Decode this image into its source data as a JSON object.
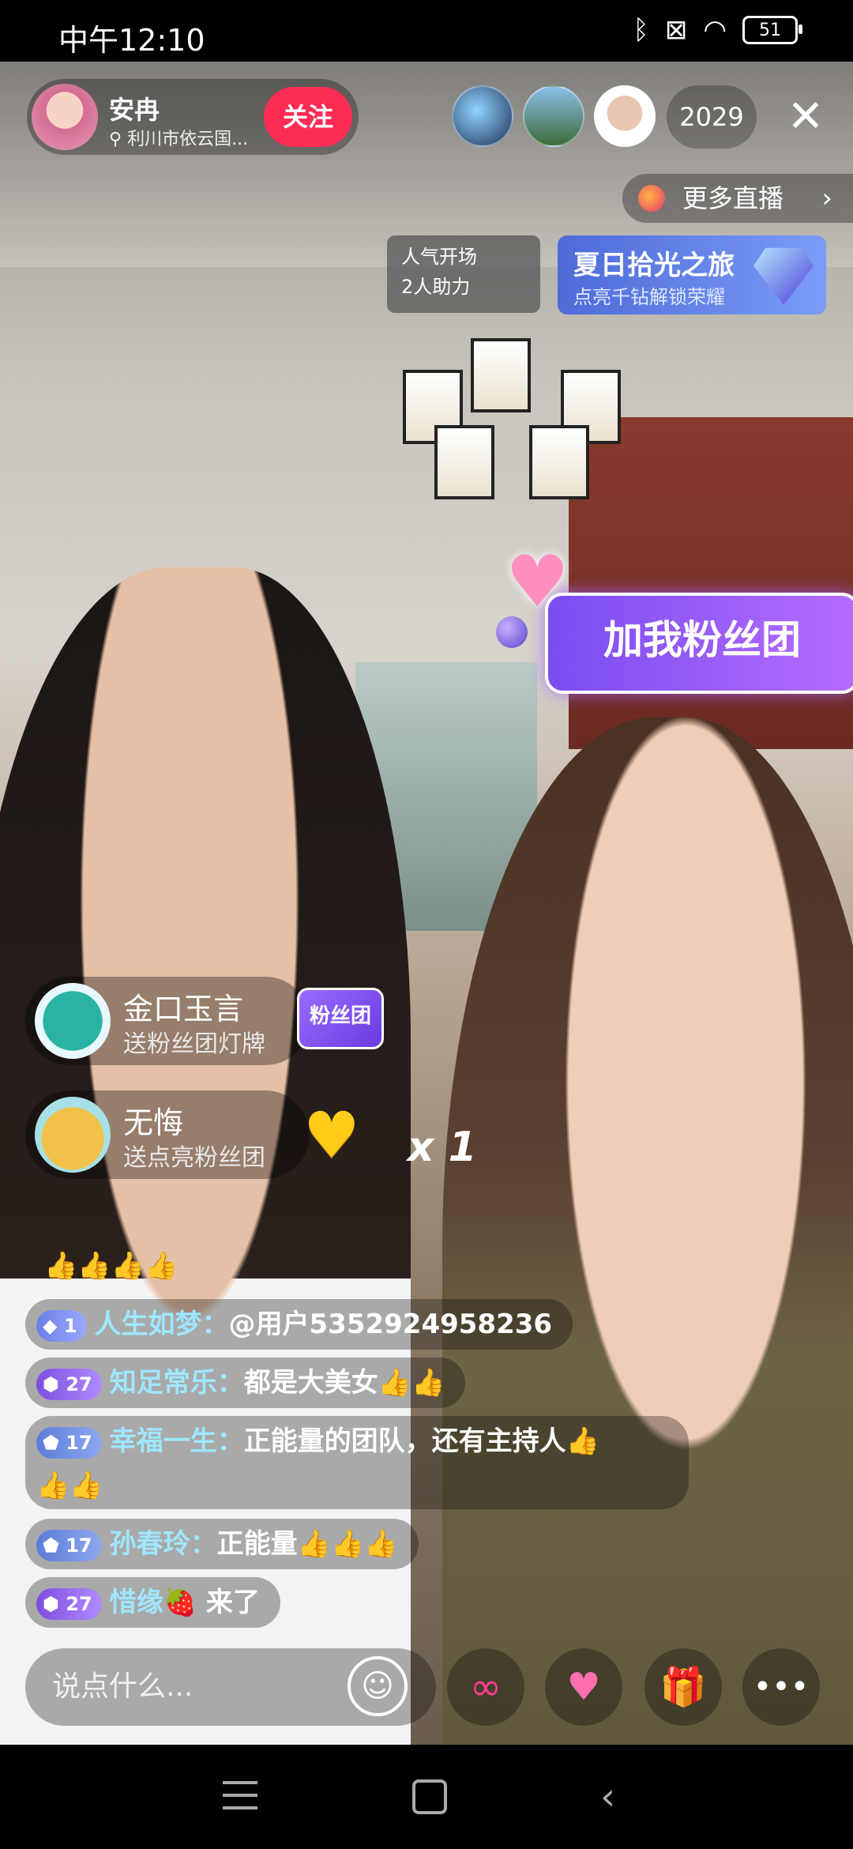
{
  "status_bar": {
    "time": "中午12:10",
    "battery": "51"
  },
  "host": {
    "name": "安冉",
    "location": "利川市依云国...",
    "follow_label": "关注"
  },
  "viewers": {
    "count": "2029"
  },
  "more_live": {
    "label": "更多直播"
  },
  "popular": {
    "line1": "人气开场",
    "line2": "2人助力"
  },
  "event": {
    "title": "夏日拾光之旅",
    "subtitle": "点亮千钻解锁荣耀"
  },
  "fan_sticker": {
    "label": "加我粉丝团"
  },
  "gifts": [
    {
      "user": "金口玉言",
      "desc": "送粉丝团灯牌",
      "badge": "粉丝团"
    },
    {
      "user": "无悔",
      "desc": "送点亮粉丝团",
      "combo": "x 1"
    }
  ],
  "thumbs_row": "👍👍👍👍",
  "chat": [
    {
      "level": "1",
      "user": "人生如梦：",
      "message": "@用户5352924958236"
    },
    {
      "level": "27",
      "user": "知足常乐：",
      "message": "都是大美女👍👍"
    },
    {
      "level": "17",
      "user": "幸福一生：",
      "message": "正能量的团队，还有主持人👍",
      "message2": "👍👍"
    },
    {
      "level": "17",
      "user": "孙春玲：",
      "message": "正能量👍👍👍"
    },
    {
      "level": "27",
      "user": "惜缘🍓",
      "message": " 来了"
    }
  ],
  "input": {
    "placeholder": "说点什么..."
  }
}
